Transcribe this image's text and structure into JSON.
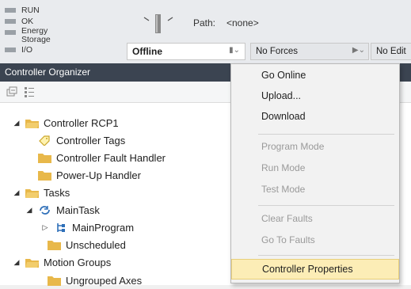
{
  "status_panel": {
    "leds": [
      {
        "label": "RUN"
      },
      {
        "label": "OK"
      },
      {
        "label": "Energy Storage"
      },
      {
        "label": "I/O"
      }
    ],
    "path_label": "Path:",
    "path_value": "<none>",
    "mode": "Offline",
    "forces": "No Forces",
    "edits": "No Edit"
  },
  "organizer": {
    "title": "Controller Organizer",
    "toolbar_icons": [
      "collapse-all-icon",
      "expand-list-icon"
    ],
    "tree": [
      {
        "label": "Controller RCP1",
        "icon": "folder-icon",
        "expanded": true
      },
      {
        "label": "Controller Tags",
        "icon": "tag-icon"
      },
      {
        "label": "Controller Fault Handler",
        "icon": "folder-icon"
      },
      {
        "label": "Power-Up Handler",
        "icon": "folder-icon"
      },
      {
        "label": "Tasks",
        "icon": "folder-icon",
        "expanded": true
      },
      {
        "label": "MainTask",
        "icon": "task-icon",
        "expanded": true
      },
      {
        "label": "MainProgram",
        "icon": "program-icon",
        "expanded": false
      },
      {
        "label": "Unscheduled",
        "icon": "folder-icon"
      },
      {
        "label": "Motion Groups",
        "icon": "folder-icon",
        "expanded": true
      },
      {
        "label": "Ungrouped Axes",
        "icon": "folder-icon"
      }
    ]
  },
  "context_menu": {
    "groups": [
      [
        {
          "label": "Go Online",
          "enabled": true
        },
        {
          "label": "Upload...",
          "enabled": true
        },
        {
          "label": "Download",
          "enabled": true
        }
      ],
      [
        {
          "label": "Program Mode",
          "enabled": false
        },
        {
          "label": "Run Mode",
          "enabled": false
        },
        {
          "label": "Test Mode",
          "enabled": false
        }
      ],
      [
        {
          "label": "Clear Faults",
          "enabled": false
        },
        {
          "label": "Go To Faults",
          "enabled": false
        }
      ],
      [
        {
          "label": "Controller Properties",
          "enabled": true,
          "highlighted": true
        }
      ]
    ]
  },
  "colors": {
    "header": "#3b4451",
    "folder": "#e8b84a",
    "menu_highlight": "#fcedb6",
    "led_off": "#9aa0a6"
  }
}
